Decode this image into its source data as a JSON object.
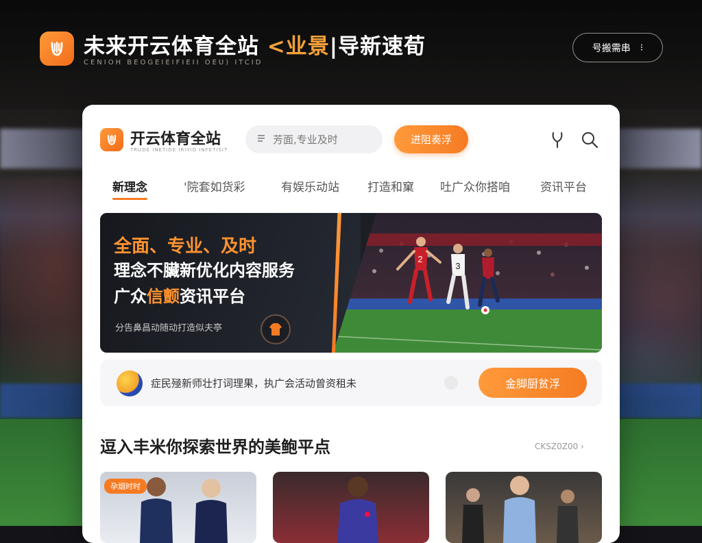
{
  "brand": {
    "title_main": "未来开云体育全站",
    "title_accent": "<业景",
    "title_tail": "|导新速荀",
    "subtitle": "CENIOH BEOGEIEIFIEII OEU) ITCID"
  },
  "header_button": {
    "label": "号搬需串",
    "icon": "info-icon"
  },
  "card": {
    "logo_title": "开云体育全站",
    "logo_subtitle": "TRUDE INETIDE IRIYID INFETISIT",
    "search": {
      "placeholder": "芳面,专业及时",
      "icon": "search-icon"
    },
    "cta_label": "进阻奏浮",
    "icons": [
      "microphone-icon",
      "search-icon"
    ]
  },
  "nav": {
    "items": [
      {
        "label": "新理念",
        "active": true
      },
      {
        "label": "'院套如货彩",
        "active": false
      },
      {
        "label": "有娱乐动站",
        "active": false
      },
      {
        "label": "打造和窠",
        "active": false
      },
      {
        "label": "吐广众你搭咱",
        "active": false
      },
      {
        "label": "资讯平台",
        "active": false
      }
    ]
  },
  "hero": {
    "line1": "全面、专业、及时",
    "line2": "理念不臟新优化内容服务",
    "line3_pre": "广众",
    "line3_highlight": "信颤",
    "line3_post": "资讯平台",
    "caption": "分告鼻昌动随动打造似夫亭"
  },
  "notice": {
    "text": "症民殛新师壮打词理果，执广会活动曾资租未",
    "button_label": "金脚厨贫浮"
  },
  "section": {
    "title": "逗入丰米你探索世界的美鲍平点",
    "more_label": "CKSZ0Z00 ›",
    "thumbs": [
      {
        "tag": "孕烟时时"
      },
      {
        "tag": ""
      },
      {
        "tag": ""
      }
    ]
  },
  "colors": {
    "accent": "#f57b23",
    "accent_light": "#ff9a3a",
    "dark": "#1d1d1f"
  }
}
